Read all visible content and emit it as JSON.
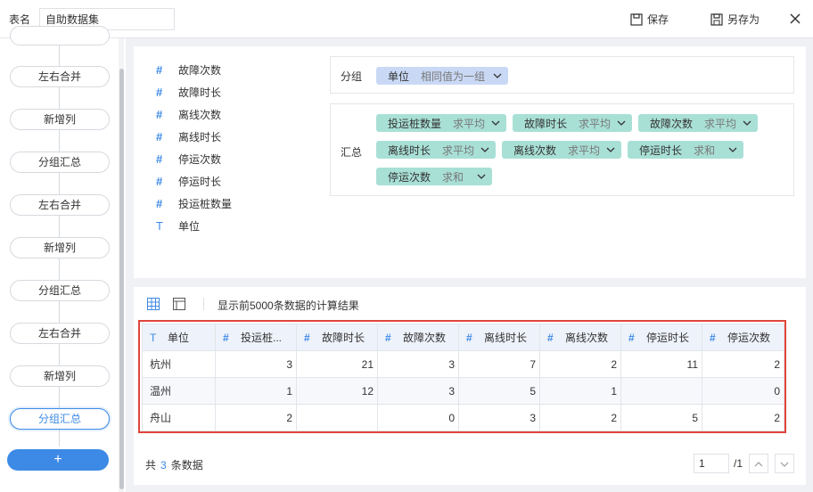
{
  "header": {
    "name_label": "表名",
    "name_value": "自助数据集",
    "save_label": "保存",
    "save_as_label": "另存为"
  },
  "flow": {
    "nodes": [
      "左右合并",
      "新增列",
      "分组汇总",
      "左右合并",
      "新增列",
      "分组汇总",
      "左右合并",
      "新增列",
      "分组汇总"
    ],
    "add_label": "+"
  },
  "fields": [
    {
      "type": "#",
      "name": "故障次数"
    },
    {
      "type": "#",
      "name": "故障时长"
    },
    {
      "type": "#",
      "name": "离线次数"
    },
    {
      "type": "#",
      "name": "离线时长"
    },
    {
      "type": "#",
      "name": "停运次数"
    },
    {
      "type": "#",
      "name": "停运时长"
    },
    {
      "type": "#",
      "name": "投运桩数量"
    },
    {
      "type": "T",
      "name": "单位"
    }
  ],
  "group": {
    "label": "分组",
    "tags": [
      {
        "name": "单位",
        "agg": "相同值为一组"
      }
    ]
  },
  "summary": {
    "label": "汇总",
    "tags": [
      {
        "name": "投运桩数量",
        "agg": "求平均"
      },
      {
        "name": "故障时长",
        "agg": "求平均"
      },
      {
        "name": "故障次数",
        "agg": "求平均"
      },
      {
        "name": "离线时长",
        "agg": "求平均"
      },
      {
        "name": "离线次数",
        "agg": "求平均"
      },
      {
        "name": "停运时长",
        "agg": "求和"
      },
      {
        "name": "停运次数",
        "agg": "求和"
      }
    ]
  },
  "result": {
    "hint": "显示前5000条数据的计算结果",
    "columns": [
      {
        "type": "T",
        "name": "单位"
      },
      {
        "type": "#",
        "name": "投运桩..."
      },
      {
        "type": "#",
        "name": "故障时长"
      },
      {
        "type": "#",
        "name": "故障次数"
      },
      {
        "type": "#",
        "name": "离线时长"
      },
      {
        "type": "#",
        "name": "离线次数"
      },
      {
        "type": "#",
        "name": "停运时长"
      },
      {
        "type": "#",
        "name": "停运次数"
      }
    ],
    "rows": [
      [
        "杭州",
        "3",
        "21",
        "3",
        "7",
        "2",
        "11",
        "2"
      ],
      [
        "温州",
        "1",
        "12",
        "3",
        "5",
        "1",
        "",
        "0"
      ],
      [
        "舟山",
        "2",
        "",
        "0",
        "3",
        "2",
        "5",
        "2"
      ]
    ],
    "count_prefix": "共",
    "count": "3",
    "count_suffix": "条数据"
  },
  "pagination": {
    "current": "1",
    "total": "/1"
  },
  "colors": {
    "accent": "#3d8ae6",
    "group_tag": "#c9d9f5",
    "summary_tag": "#a9e0d6",
    "highlight_border": "#e0453c"
  }
}
